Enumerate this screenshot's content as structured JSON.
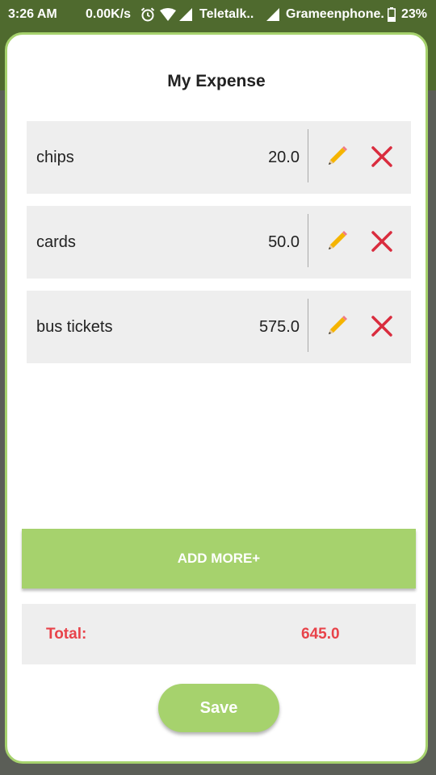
{
  "status_bar": {
    "time": "3:26 AM",
    "speed": "0.00K/s",
    "carrier1": "Teletalk..",
    "carrier2": "Grameenphone.",
    "battery": "23%",
    "icons": [
      "alarm-icon",
      "wifi-icon",
      "signal-icon",
      "signal-icon",
      "battery-icon"
    ]
  },
  "dialog": {
    "title": "My Expense",
    "items": [
      {
        "name": "chips",
        "amount": "20.0"
      },
      {
        "name": "cards",
        "amount": "50.0"
      },
      {
        "name": "bus tickets",
        "amount": "575.0"
      }
    ],
    "add_more_label": "ADD MORE+",
    "total_label": "Total:",
    "total_value": "645.0",
    "save_label": "Save"
  },
  "colors": {
    "accent": "#a6d26d",
    "total_text": "#e8434a",
    "delete_icon": "#d92c3e",
    "edit_icon": "#f5b400",
    "row_bg": "#eeeeee"
  }
}
